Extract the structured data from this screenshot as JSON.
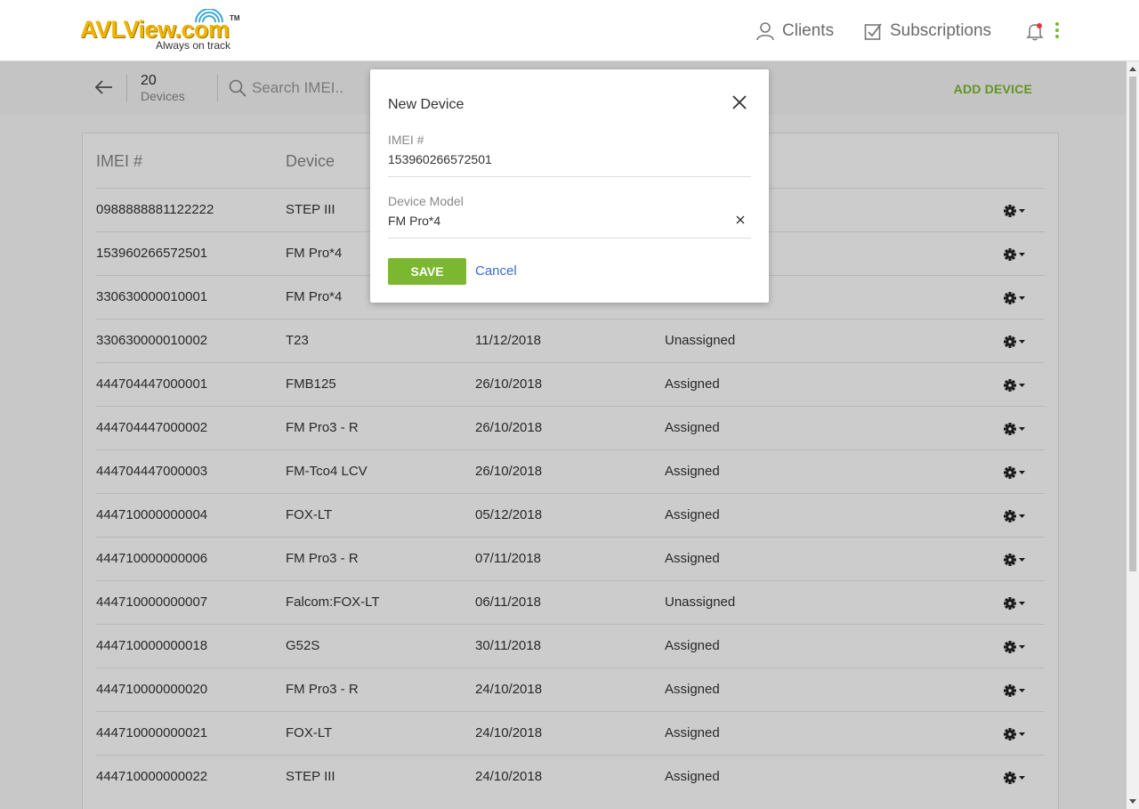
{
  "header": {
    "logo_text": "AVLView.com",
    "logo_tm": "TM",
    "logo_tagline": "Always on track",
    "nav": [
      {
        "label": "Clients",
        "icon": "user-icon"
      },
      {
        "label": "Subscriptions",
        "icon": "checkbox-icon"
      }
    ],
    "notification_icon": "bell-icon",
    "menu_icon": "kebab-menu-icon"
  },
  "toolbar": {
    "device_count": "20",
    "device_label": "Devices",
    "search_placeholder": "Search IMEI..",
    "add_device_label": "ADD DEVICE"
  },
  "table": {
    "columns": [
      "IMEI #",
      "Device"
    ],
    "rows": [
      {
        "imei": "0988888881122222",
        "device": "STEP III",
        "date": "",
        "status": ""
      },
      {
        "imei": "153960266572501",
        "device": "FM Pro*4",
        "date": "",
        "status": ""
      },
      {
        "imei": "330630000010001",
        "device": "FM Pro*4",
        "date": "",
        "status": ""
      },
      {
        "imei": "330630000010002",
        "device": "T23",
        "date": "11/12/2018",
        "status": "Unassigned"
      },
      {
        "imei": "444704447000001",
        "device": "FMB125",
        "date": "26/10/2018",
        "status": "Assigned"
      },
      {
        "imei": "444704447000002",
        "device": "FM Pro3 - R",
        "date": "26/10/2018",
        "status": "Assigned"
      },
      {
        "imei": "444704447000003",
        "device": "FM-Tco4 LCV",
        "date": "26/10/2018",
        "status": "Assigned"
      },
      {
        "imei": "444710000000004",
        "device": "FOX-LT",
        "date": "05/12/2018",
        "status": "Assigned"
      },
      {
        "imei": "444710000000006",
        "device": "FM Pro3 - R",
        "date": "07/11/2018",
        "status": "Assigned"
      },
      {
        "imei": "444710000000007",
        "device": "Falcom:FOX-LT",
        "date": "06/11/2018",
        "status": "Unassigned"
      },
      {
        "imei": "444710000000018",
        "device": "G52S",
        "date": "30/11/2018",
        "status": "Assigned"
      },
      {
        "imei": "444710000000020",
        "device": "FM Pro3 - R",
        "date": "24/10/2018",
        "status": "Assigned"
      },
      {
        "imei": "444710000000021",
        "device": "FOX-LT",
        "date": "24/10/2018",
        "status": "Assigned"
      },
      {
        "imei": "444710000000022",
        "device": "STEP III",
        "date": "24/10/2018",
        "status": "Assigned"
      }
    ],
    "row_action_icon": "gear-dropdown-icon"
  },
  "dialog": {
    "title": "New Device",
    "imei_label": "IMEI #",
    "imei_value": "153960266572501",
    "model_label": "Device Model",
    "model_value": "FM Pro*4",
    "save_label": "SAVE",
    "cancel_label": "Cancel"
  },
  "colors": {
    "accent_green": "#7cb82f",
    "link_blue": "#3b6ccf",
    "logo_yellow": "#f0b400",
    "notification_red": "#e53935"
  }
}
